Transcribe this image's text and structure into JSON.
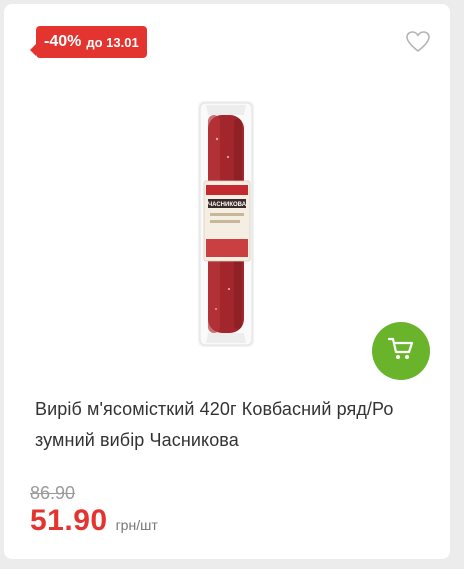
{
  "badge": {
    "discount": "-40%",
    "until": "до 13.01"
  },
  "product": {
    "title_line1": "Виріб м'ясомісткий 420г Ковбасний ряд/Ро",
    "title_line2": "зумний вибір Часникова",
    "old_price": "86.90",
    "price": "51.90",
    "unit": "грн/шт",
    "label_text": "ЧАСНИКОВА"
  },
  "icons": {
    "favorite": "heart-icon",
    "cart": "cart-icon"
  },
  "colors": {
    "accent_red": "#e3342f",
    "cart_green": "#6ab42c"
  }
}
